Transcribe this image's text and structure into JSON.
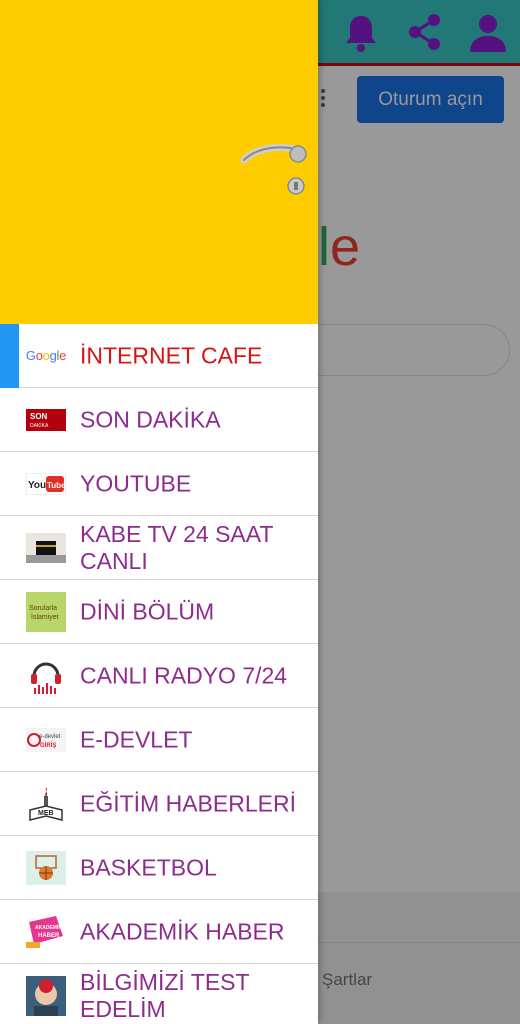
{
  "background_page": {
    "signin_label": "Oturum açın",
    "logo_fragment": [
      "l",
      "e"
    ],
    "footer_link": "Şartlar"
  },
  "top_bar_icons": [
    "bell-icon",
    "share-icon",
    "account-icon"
  ],
  "colors": {
    "top_bar": "#39c6c6",
    "top_bar_border": "#d00a12",
    "icon_purple": "#8a1ed6",
    "drawer_header": "#ffcc00",
    "active_indicator": "#2196f3",
    "active_label": "#d81313",
    "label": "#8e2c8e"
  },
  "drawer": {
    "items": [
      {
        "label": "İNTERNET CAFE",
        "icon": "google-icon",
        "active": true
      },
      {
        "label": "SON DAKİKA",
        "icon": "son-dakika-icon"
      },
      {
        "label": "YOUTUBE",
        "icon": "youtube-icon"
      },
      {
        "label": "KABE TV 24 SAAT CANLI",
        "icon": "kaaba-icon"
      },
      {
        "label": "DİNİ BÖLÜM",
        "icon": "religion-icon"
      },
      {
        "label": "CANLI RADYO 7/24",
        "icon": "headphones-icon"
      },
      {
        "label": "E-DEVLET",
        "icon": "e-devlet-icon"
      },
      {
        "label": "EĞİTİM HABERLERİ",
        "icon": "meb-icon"
      },
      {
        "label": "BASKETBOL",
        "icon": "basketball-icon"
      },
      {
        "label": "AKADEMİK HABER",
        "icon": "akademik-haber-icon"
      },
      {
        "label": "BİLGİMİZİ TEST EDELİM",
        "icon": "quiz-icon"
      }
    ],
    "icon_text": {
      "google": [
        "G",
        "o",
        "o",
        "g",
        "l",
        "e"
      ],
      "son_dakika": [
        "SON",
        "DAKİKA"
      ],
      "youtube": "You",
      "youtube_tube": "Tube",
      "religion": [
        "Sorularla",
        "İslamiyet"
      ],
      "e_devlet": [
        "e-devlet",
        "GİRİŞ"
      ],
      "meb": "MEB",
      "akademik": [
        "AKADEMİK",
        "HABER"
      ]
    }
  }
}
